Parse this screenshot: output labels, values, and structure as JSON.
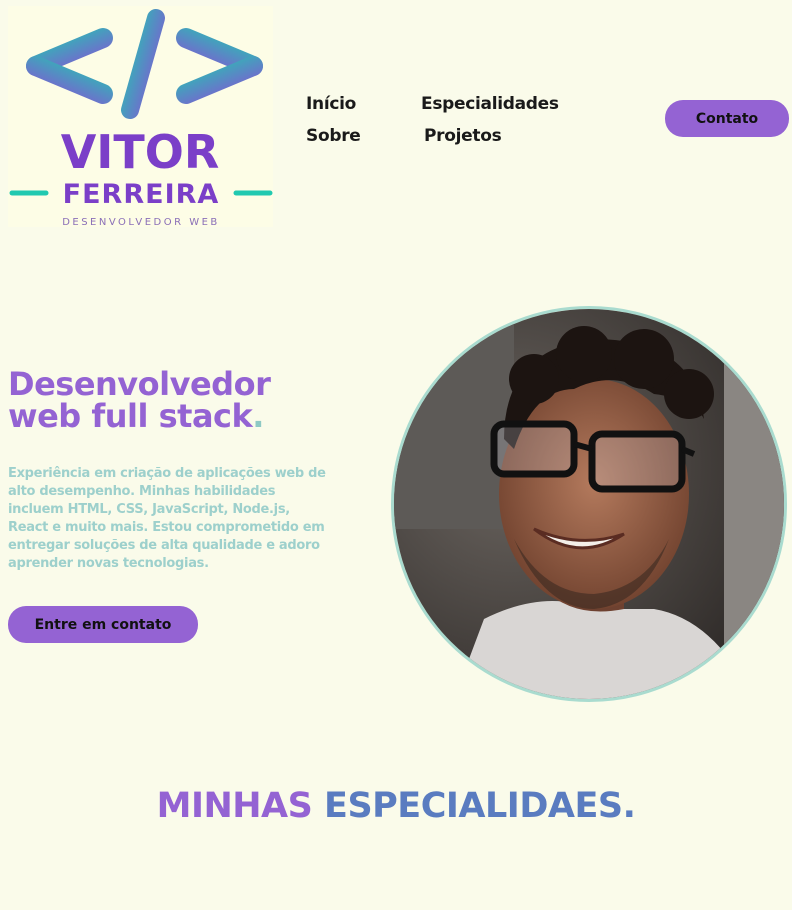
{
  "logo": {
    "name_top": "VITOR",
    "name_bottom": "FERREIRA",
    "tagline": "DESENVOLVEDOR WEB",
    "icon": "code-brackets-logo"
  },
  "nav": {
    "items": [
      {
        "label": "Início"
      },
      {
        "label": "Especialidades"
      },
      {
        "label": "Sobre"
      },
      {
        "label": "Projetos"
      }
    ],
    "contact_button": "Contato"
  },
  "hero": {
    "title_line1": "Desenvolvedor",
    "title_line2": "web full stack",
    "title_dot": ".",
    "description": "Experiência em criação de aplicações web de alto desempenho. Minhas habilidades incluem HTML, CSS, JavaScript, Node.js, React e muito mais. Estou comprometido em entregar soluções de alta qualidade e adoro aprender novas tecnologias.",
    "cta_button": "Entre em contato"
  },
  "section": {
    "title_part1": "MINHAS",
    "title_part2": "ESPECIALIDAES."
  },
  "colors": {
    "background": "#fafbea",
    "accent_purple": "#9463d3",
    "accent_teal": "#9dd0cc",
    "accent_blue": "#5a7cc0"
  }
}
